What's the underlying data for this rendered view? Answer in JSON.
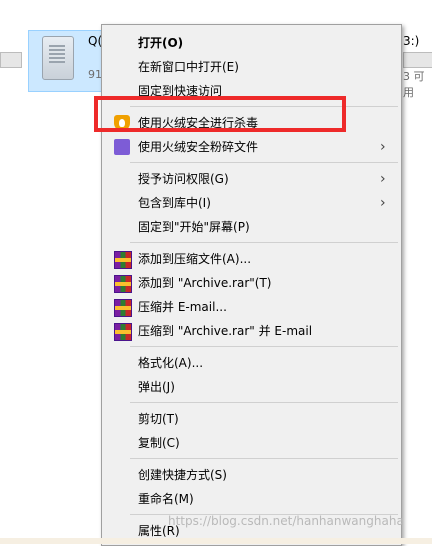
{
  "explorer": {
    "drive_name": "Q(",
    "drive_free": "91",
    "right_name": "3:)",
    "right_free": "3 可用"
  },
  "menu": {
    "items": [
      {
        "label": "打开(O)",
        "bold": true
      },
      {
        "label": "在新窗口中打开(E)"
      },
      {
        "label": "固定到快速访问"
      },
      {
        "label": "使用火绒安全进行杀毒",
        "icon": "huorong-fire-icon"
      },
      {
        "label": "使用火绒安全粉碎文件",
        "icon": "huorong-shred-icon",
        "submenu": true
      },
      {
        "label": "授予访问权限(G)",
        "submenu": true
      },
      {
        "label": "包含到库中(I)",
        "submenu": true
      },
      {
        "label": "固定到\"开始\"屏幕(P)"
      },
      {
        "label": "添加到压缩文件(A)...",
        "icon": "winrar-icon"
      },
      {
        "label": "添加到 \"Archive.rar\"(T)",
        "icon": "winrar-icon"
      },
      {
        "label": "压缩并 E-mail...",
        "icon": "winrar-icon"
      },
      {
        "label": "压缩到 \"Archive.rar\" 并 E-mail",
        "icon": "winrar-icon"
      },
      {
        "label": "格式化(A)..."
      },
      {
        "label": "弹出(J)"
      },
      {
        "label": "剪切(T)"
      },
      {
        "label": "复制(C)"
      },
      {
        "label": "创建快捷方式(S)"
      },
      {
        "label": "重命名(M)"
      },
      {
        "label": "属性(R)"
      }
    ],
    "submenu_arrow": "›"
  },
  "annotation": {
    "highlight_color": "#ee2a2a"
  },
  "watermark": "https://blog.csdn.net/hanhanwanghaha"
}
